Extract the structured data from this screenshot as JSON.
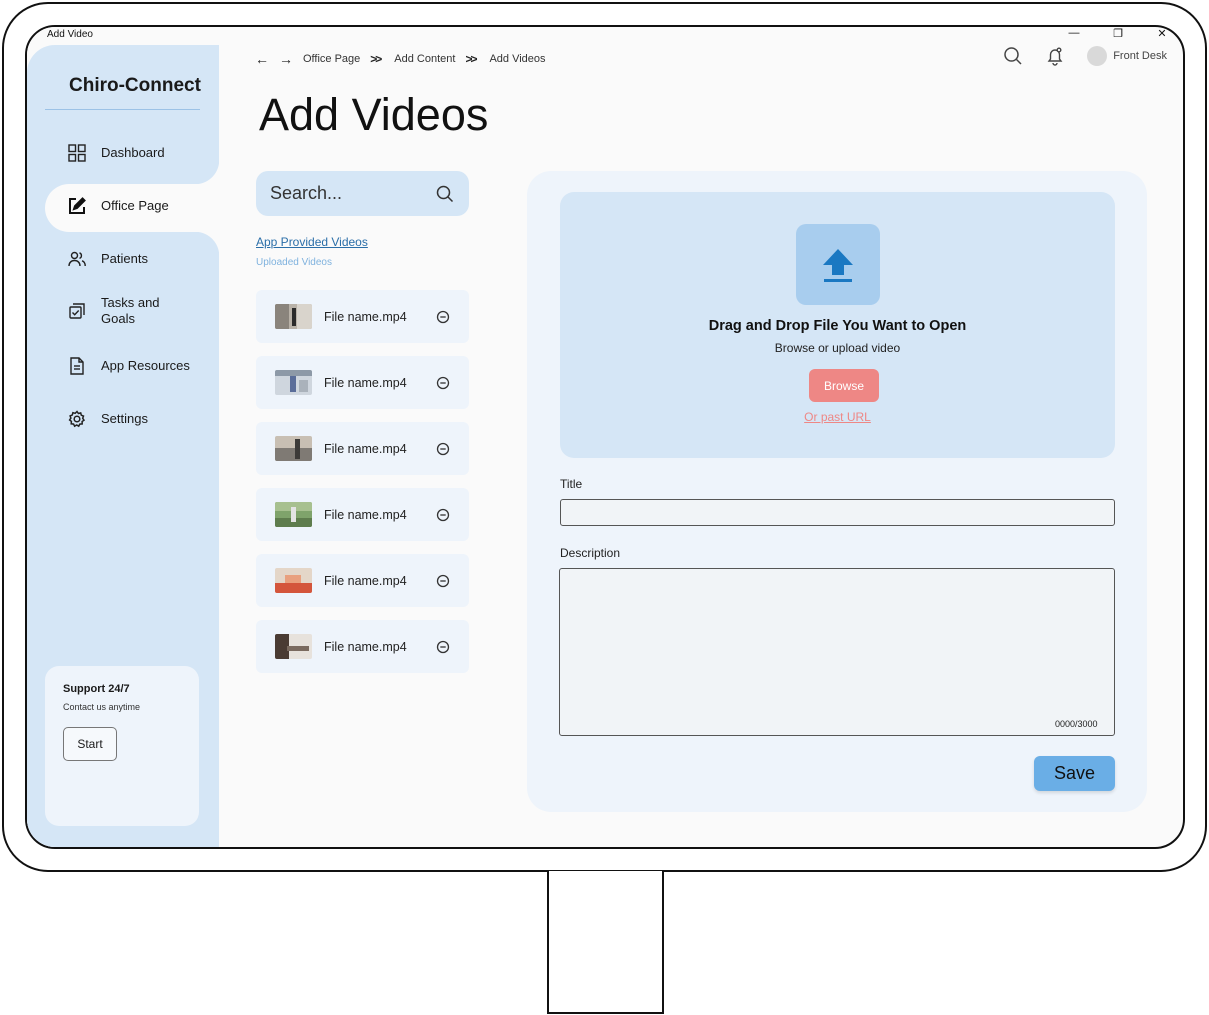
{
  "window": {
    "title": "Add Video",
    "minimize": "—",
    "restore": "❐",
    "close": "✕"
  },
  "sidebar": {
    "brand": "Chiro-Connect",
    "items": [
      {
        "label": "Dashboard",
        "icon": "dashboard-grid-icon"
      },
      {
        "label": "Office Page",
        "icon": "edit-square-icon",
        "active": true
      },
      {
        "label": "Patients",
        "icon": "users-icon"
      },
      {
        "label": "Tasks and Goals",
        "icon": "tasks-icon"
      },
      {
        "label": "App Resources",
        "icon": "document-icon"
      },
      {
        "label": "Settings",
        "icon": "gear-icon"
      }
    ],
    "support": {
      "title": "Support 24/7",
      "subtitle": "Contact us anytime",
      "button": "Start"
    }
  },
  "header": {
    "breadcrumb": [
      "Office Page",
      "Add Content",
      "Add Videos"
    ],
    "user": "Front Desk",
    "page_title": "Add Videos"
  },
  "library": {
    "search_placeholder": "Search...",
    "tab_provided": "App Provided Videos",
    "tab_uploaded": "Uploaded Videos",
    "files": [
      {
        "name": "File name.mp4"
      },
      {
        "name": "File name.mp4"
      },
      {
        "name": "File name.mp4"
      },
      {
        "name": "File name.mp4"
      },
      {
        "name": "File name.mp4"
      },
      {
        "name": "File name.mp4"
      }
    ]
  },
  "upload": {
    "drop_title": "Drag and Drop File You  Want to Open",
    "drop_subtitle": "Browse or upload video",
    "browse_label": "Browse",
    "url_link": "Or past URL",
    "title_label": "Title",
    "title_value": "",
    "description_label": "Description",
    "description_value": "",
    "char_count": "0000/3000",
    "save_label": "Save"
  },
  "colors": {
    "sidebar_bg": "#d5e6f6",
    "panel_bg": "#eef4fb",
    "browse": "#ee8785",
    "save": "#6aaee6",
    "upload_arrow": "#1a78c2"
  }
}
